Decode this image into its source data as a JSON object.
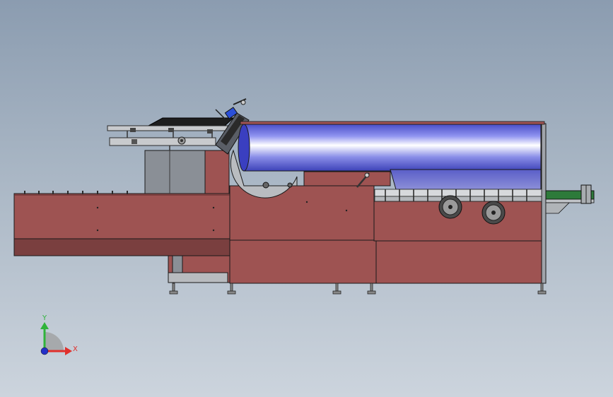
{
  "viewport": {
    "background_top": "#8b9cb0",
    "background_bottom": "#ccd4dd"
  },
  "model": {
    "frame_color": "#9e5352",
    "frame_dark_color": "#7a3f3f",
    "panel_gray": "#8a8f96",
    "hood_color": "#6f72e0",
    "outline_color": "#1a1a1a"
  },
  "triad": {
    "y_label": "Y",
    "x_label": "X",
    "y_color": "#2fb33a",
    "x_color": "#e0302c",
    "z_color": "#2430c8"
  }
}
